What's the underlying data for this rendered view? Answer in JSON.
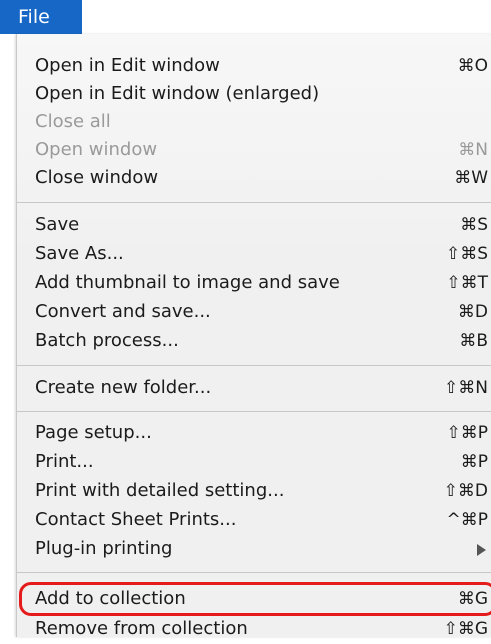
{
  "menubar": {
    "title": "File"
  },
  "menu": {
    "items": [
      {
        "label": "Open in Edit window",
        "shortcut": "⌘O",
        "disabled": false
      },
      {
        "label": "Open in Edit window (enlarged)",
        "shortcut": "",
        "disabled": false
      },
      {
        "label": "Close all",
        "shortcut": "",
        "disabled": true
      },
      {
        "label": "Open window",
        "shortcut": "⌘N",
        "disabled": true
      },
      {
        "label": "Close window",
        "shortcut": "⌘W",
        "disabled": false
      },
      {
        "label": "Save",
        "shortcut": "⌘S",
        "disabled": false
      },
      {
        "label": "Save As...",
        "shortcut": "⇧⌘S",
        "disabled": false
      },
      {
        "label": "Add thumbnail to image and save",
        "shortcut": "⇧⌘T",
        "disabled": false
      },
      {
        "label": "Convert and save...",
        "shortcut": "⌘D",
        "disabled": false
      },
      {
        "label": "Batch process...",
        "shortcut": "⌘B",
        "disabled": false
      },
      {
        "label": "Create new folder...",
        "shortcut": "⇧⌘N",
        "disabled": false
      },
      {
        "label": "Page setup...",
        "shortcut": "⇧⌘P",
        "disabled": false
      },
      {
        "label": "Print...",
        "shortcut": "⌘P",
        "disabled": false
      },
      {
        "label": "Print with detailed setting...",
        "shortcut": "⇧⌘D",
        "disabled": false
      },
      {
        "label": "Contact Sheet Prints...",
        "shortcut": "^⌘P",
        "disabled": false
      },
      {
        "label": "Plug-in printing",
        "shortcut": "",
        "disabled": false,
        "submenu": true
      },
      {
        "label": "Add to collection",
        "shortcut": "⌘G",
        "disabled": false,
        "highlighted": true
      },
      {
        "label": "Remove from collection",
        "shortcut": "⇧⌘G",
        "disabled": false
      }
    ]
  },
  "colors": {
    "menubar_accent": "#1767c7",
    "highlight_outline": "#e51a1a",
    "disabled_text": "#9a9a9a"
  }
}
